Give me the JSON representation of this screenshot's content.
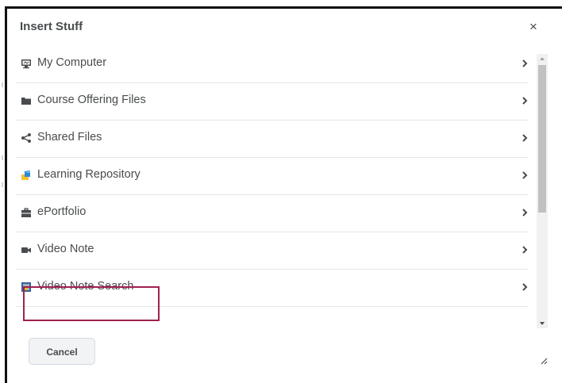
{
  "dialog": {
    "title": "Insert Stuff",
    "close_symbol": "×",
    "items": [
      {
        "label": "My Computer",
        "icon": "computer-icon"
      },
      {
        "label": "Course Offering Files",
        "icon": "folder-icon"
      },
      {
        "label": "Shared Files",
        "icon": "share-icon"
      },
      {
        "label": "Learning Repository",
        "icon": "repository-icon"
      },
      {
        "label": "ePortfolio",
        "icon": "briefcase-icon"
      },
      {
        "label": "Video Note",
        "icon": "video-camera-icon"
      },
      {
        "label": "Video Note Search",
        "icon": "video-note-search-icon"
      }
    ],
    "cancel_label": "Cancel"
  },
  "colors": {
    "highlight_border": "#a02050",
    "text": "#494c4e",
    "divider": "#e3e6e9"
  }
}
